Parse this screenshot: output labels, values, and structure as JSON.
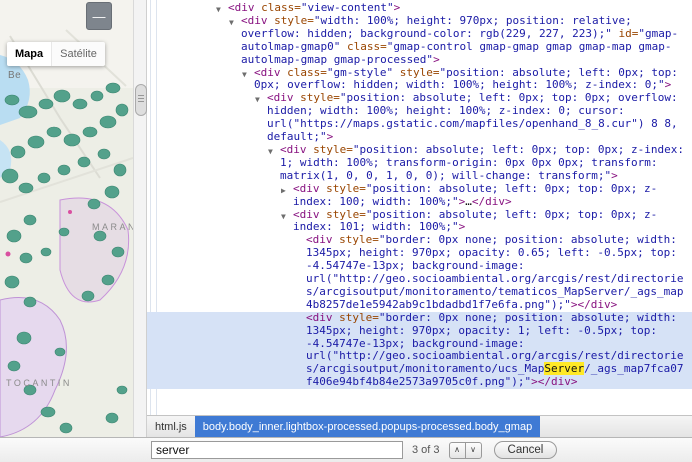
{
  "colors": {
    "breadcrumb_selected": "#3f7ad4",
    "search_match_highlight": "#ffe926",
    "selected_node_bg": "#d6e2f6",
    "syntax_tag": "#881280",
    "syntax_attr": "#994500",
    "syntax_value": "#1a1aa6",
    "map_forest_green": "#53a18b",
    "map_region_purple": "#c892da"
  },
  "map": {
    "minus_glyph": "—",
    "type_buttons": [
      {
        "label": "Mapa"
      },
      {
        "label": "Satélite"
      }
    ],
    "labels": [
      {
        "text": "Be"
      },
      {
        "text": "MARAN"
      },
      {
        "text": "TOCANTIN"
      }
    ]
  },
  "devtools": {
    "tree": [
      {
        "indent": 0,
        "marker": "▼",
        "selected": false,
        "segments": [
          [
            "t",
            "<div"
          ],
          [
            "a",
            " class="
          ],
          [
            "v",
            "\"view-content\""
          ],
          [
            "t",
            ">"
          ]
        ]
      },
      {
        "indent": 1,
        "marker": "▼",
        "selected": false,
        "segments": [
          [
            "t",
            "<div"
          ],
          [
            "a",
            " style="
          ],
          [
            "v",
            "\"width: 100%; height: 970px; position: relative; overflow: hidden; background-color: rgb(229, 227, 223);\""
          ],
          [
            "a",
            " id="
          ],
          [
            "v",
            "\"gmap-autolmap-gmap0\""
          ],
          [
            "a",
            " class="
          ],
          [
            "v",
            "\"gmap-control gmap-gmap gmap gmap-map gmap-autolmap-gmap gmap-processed\""
          ],
          [
            "t",
            ">"
          ]
        ]
      },
      {
        "indent": 2,
        "marker": "▼",
        "selected": false,
        "segments": [
          [
            "t",
            "<div"
          ],
          [
            "a",
            " class="
          ],
          [
            "v",
            "\"gm-style\""
          ],
          [
            "a",
            " style="
          ],
          [
            "v",
            "\"position: absolute; left: 0px; top: 0px; overflow: hidden; width: 100%; height: 100%; z-index: 0;\""
          ],
          [
            "t",
            ">"
          ]
        ]
      },
      {
        "indent": 3,
        "marker": "▼",
        "selected": false,
        "segments": [
          [
            "t",
            "<div"
          ],
          [
            "a",
            " style="
          ],
          [
            "v",
            "\"position: absolute; left: 0px; top: 0px; overflow: hidden; width: 100%; height: 100%; z-index: 0; cursor: url(\"https://maps.gstatic.com/mapfiles/openhand_8_8.cur\") 8 8, default;\""
          ],
          [
            "t",
            ">"
          ]
        ]
      },
      {
        "indent": 4,
        "marker": "▼",
        "selected": false,
        "segments": [
          [
            "t",
            "<div"
          ],
          [
            "a",
            " style="
          ],
          [
            "v",
            "\"position: absolute; left: 0px; top: 0px; z-index: 1; width: 100%; transform-origin: 0px 0px 0px; transform: matrix(1, 0, 0, 1, 0, 0); will-change: transform;\""
          ],
          [
            "t",
            ">"
          ]
        ]
      },
      {
        "indent": 5,
        "marker": "▶",
        "selected": false,
        "segments": [
          [
            "t",
            "<div"
          ],
          [
            "a",
            " style="
          ],
          [
            "v",
            "\"position: absolute; left: 0px; top: 0px; z-index: 100; width: 100%;\""
          ],
          [
            "t",
            ">"
          ],
          [
            "p",
            "…"
          ],
          [
            "t",
            "</div>"
          ]
        ]
      },
      {
        "indent": 5,
        "marker": "▼",
        "selected": false,
        "segments": [
          [
            "t",
            "<div"
          ],
          [
            "a",
            " style="
          ],
          [
            "v",
            "\"position: absolute; left: 0px; top: 0px; z-index: 101; width: 100%;\""
          ],
          [
            "t",
            ">"
          ]
        ]
      },
      {
        "indent": 6,
        "marker": "",
        "selected": false,
        "segments": [
          [
            "t",
            "<div"
          ],
          [
            "a",
            " style="
          ],
          [
            "v",
            "\"border: 0px none; position: absolute; width: 1345px; height: 970px; opacity: 0.65; left: -0.5px; top: -4.54747e-13px; background-image: url(\"http://geo.socioambiental.org/arcgis/rest/directories/arcgisoutput/monitoramento/tematicos_MapServer/_ags_map4b8257de1e5942ab9c1bdadbd1f7e6fa.png\");\""
          ],
          [
            "t",
            ">"
          ],
          [
            "t",
            "</div>"
          ]
        ]
      },
      {
        "indent": 6,
        "marker": "",
        "selected": true,
        "segments": [
          [
            "t",
            "<div"
          ],
          [
            "a",
            " style="
          ],
          [
            "v",
            "\"border: 0px none; position: absolute; width: 1345px; height: 970px; opacity: 1; left: -0.5px; top: -4.54747e-13px; background-image: url(\"http://geo.socioambiental.org/arcgis/rest/directories/arcgisoutput/monitoramento/ucs_Map"
          ],
          [
            "h",
            "Server"
          ],
          [
            "v",
            "/_ags_map7fca07f406e94bf4b84e2573a9705c0f.png\");\""
          ],
          [
            "t",
            ">"
          ],
          [
            "t",
            "</div>"
          ]
        ]
      }
    ],
    "breadcrumbs": [
      {
        "label": "html.js",
        "selected": false
      },
      {
        "label": "body.body_inner.lightbox-processed.popups-processed.body_gmap",
        "selected": true
      }
    ],
    "find": {
      "query": "server",
      "matches": "3 of 3",
      "prev_glyph": "∧",
      "next_glyph": "∨",
      "cancel_label": "Cancel"
    }
  }
}
